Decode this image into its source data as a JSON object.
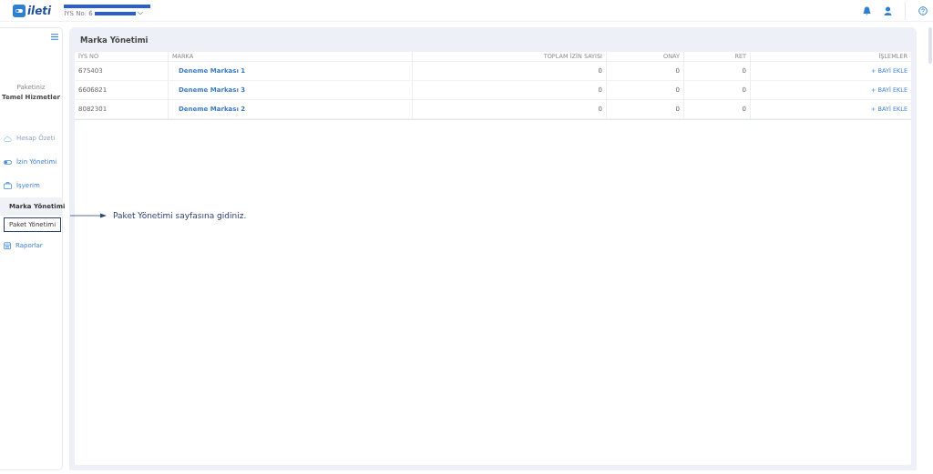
{
  "header": {
    "logo": "ileti",
    "iys_label": "İYS No: 6"
  },
  "sidebar": {
    "package_label": "Paketiniz",
    "package_name": "Temel Hizmetler",
    "items": [
      {
        "label": "Hesap Özeti",
        "disabled": true
      },
      {
        "label": "İzin Yönetimi",
        "disabled": false
      },
      {
        "label": "İşyerim",
        "disabled": false,
        "children": [
          {
            "label": "Marka Yönetimi",
            "selected": true,
            "highlighted": false
          },
          {
            "label": "Paket Yönetimi",
            "selected": false,
            "highlighted": true
          }
        ]
      },
      {
        "label": "Raporlar",
        "disabled": false
      }
    ]
  },
  "page": {
    "title": "Marka Yönetimi"
  },
  "table": {
    "columns": [
      "İYS NO",
      "MARKA",
      "TOPLAM İZİN SAYISI",
      "ONAY",
      "RET",
      "İŞLEMLER"
    ],
    "rows": [
      {
        "iys_no": "675403",
        "brand": "Deneme Markası 1",
        "total": "0",
        "approved": "0",
        "rejected": "0",
        "action": "+ BAYİ EKLE"
      },
      {
        "iys_no": "6606821",
        "brand": "Deneme Markası 3",
        "total": "0",
        "approved": "0",
        "rejected": "0",
        "action": "+ BAYİ EKLE"
      },
      {
        "iys_no": "8082301",
        "brand": "Deneme Markası 2",
        "total": "0",
        "approved": "0",
        "rejected": "0",
        "action": "+ BAYİ EKLE"
      }
    ]
  },
  "annotation": {
    "text": "Paket Yönetimi sayfasına gidiniz."
  }
}
